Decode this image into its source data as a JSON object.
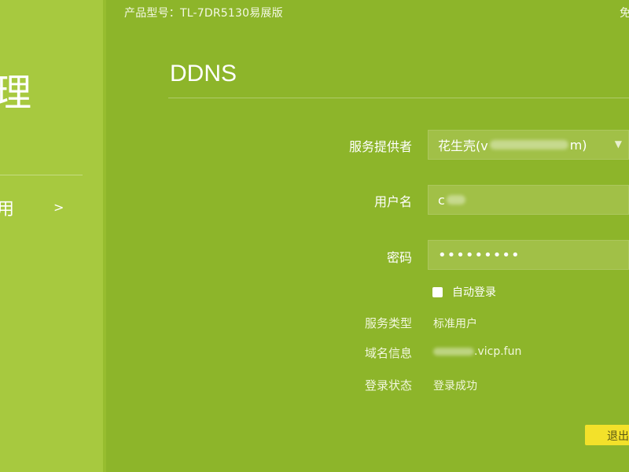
{
  "header": {
    "model_line": "产品型号：TL-7DR5130易展版",
    "corner_text": "免"
  },
  "sidebar": {
    "section_char": "理",
    "menu_item_label": "用",
    "menu_item_chevron": ">"
  },
  "page": {
    "title": "DDNS"
  },
  "form": {
    "provider_label": "服务提供者",
    "provider_value_prefix": "花生壳(v",
    "provider_value_suffix": "m)",
    "username_label": "用户名",
    "username_value_prefix": "c",
    "password_label": "密码",
    "password_value": "•••••••••",
    "auto_login_label": "自动登录",
    "auto_login_checked": false
  },
  "status": {
    "service_type_label": "服务类型",
    "service_type_value": "标准用户",
    "domain_label": "域名信息",
    "domain_value_suffix": ".vicp.fun",
    "login_status_label": "登录状态",
    "login_status_value": "登录成功"
  },
  "actions": {
    "logout_label": "退出"
  },
  "colors": {
    "background": "#8db52a",
    "sidebar": "#a7c93f",
    "button": "#f3e12a"
  }
}
